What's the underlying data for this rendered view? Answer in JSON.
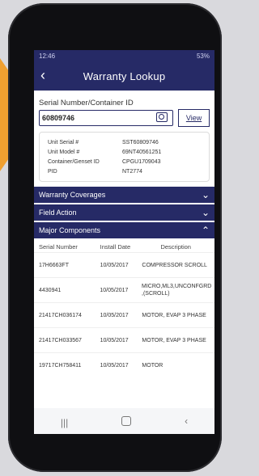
{
  "status": {
    "time": "12:46",
    "battery": "53%"
  },
  "appbar": {
    "title": "Warranty Lookup"
  },
  "search": {
    "label": "Serial Number/Container ID",
    "value": "60809746",
    "view_label": "View"
  },
  "info": [
    {
      "label": "Unit Serial #",
      "value": "SST60809746"
    },
    {
      "label": "Unit Model #",
      "value": "69NT40561251"
    },
    {
      "label": "Container/Genset ID",
      "value": "CPGU1709043"
    },
    {
      "label": "PID",
      "value": "NT2774"
    }
  ],
  "sections": {
    "warranty": "Warranty Coverages",
    "field": "Field Action",
    "major": "Major Components"
  },
  "table": {
    "headers": [
      "Serial Number",
      "Install Date",
      "Description"
    ],
    "rows": [
      [
        "17H6663FT",
        "10/05/2017",
        "COMPRESSOR SCROLL"
      ],
      [
        "4430941",
        "10/05/2017",
        "MICRO,ML3,UNCONFGRD ,(SCROLL)"
      ],
      [
        "21417CH036174",
        "10/05/2017",
        "MOTOR, EVAP 3 PHASE"
      ],
      [
        "21417CH033567",
        "10/05/2017",
        "MOTOR, EVAP 3 PHASE"
      ],
      [
        "19717CH758411",
        "10/05/2017",
        "MOTOR"
      ]
    ]
  },
  "icons": {
    "back": "back-arrow-icon",
    "camera": "camera-icon",
    "chevron_down": "chevron-down-icon",
    "chevron_up": "chevron-up-icon"
  },
  "colors": {
    "primary": "#262a66",
    "accent": "#f0a030"
  }
}
